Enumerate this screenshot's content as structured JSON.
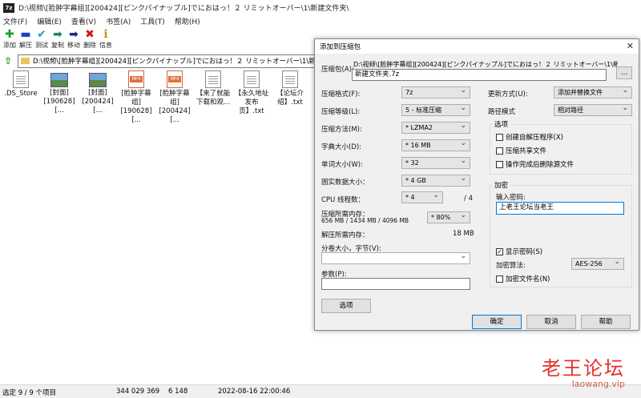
{
  "window": {
    "icon_text": "7z",
    "title": "D:\\视频\\[脸肿字幕组][200424][ピンクパイナップル]でにおはっ！２ リミットオーバー\\1\\新建文件夹\\"
  },
  "menu": [
    "文件(F)",
    "编辑(E)",
    "查看(V)",
    "书签(A)",
    "工具(T)",
    "帮助(H)"
  ],
  "toolbar": [
    {
      "label": "添加",
      "icon": "plus-icon",
      "glyph": "✚",
      "color": "#1aa01a"
    },
    {
      "label": "解压",
      "icon": "minus-icon",
      "glyph": "▬",
      "color": "#2040c0"
    },
    {
      "label": "测试",
      "icon": "check-icon",
      "glyph": "✔",
      "color": "#20a0c0"
    },
    {
      "label": "复制",
      "icon": "copy-arrow-icon",
      "glyph": "➡",
      "color": "#1a8a6a"
    },
    {
      "label": "移动",
      "icon": "move-arrow-icon",
      "glyph": "➡",
      "color": "#1a2a90"
    },
    {
      "label": "删除",
      "icon": "delete-x-icon",
      "glyph": "✖",
      "color": "#d01818"
    },
    {
      "label": "信息",
      "icon": "info-icon",
      "glyph": "ℹ",
      "color": "#c09010"
    }
  ],
  "address": {
    "path": "D:\\视频\\[脸肿字幕组][200424][ピンクパイナップル]でにおはっ！２ リミットオーバー\\1\\新建文件夹\\"
  },
  "files": [
    {
      "name": ".DS_Store",
      "type": "doc"
    },
    {
      "name": "[封面]\n[190628][...",
      "type": "img"
    },
    {
      "name": "[封面]\n[200424][...",
      "type": "img"
    },
    {
      "name": "[脸肿字幕组]\n[190628][...",
      "type": "mp4"
    },
    {
      "name": "[脸肿字幕组]\n[200424][...",
      "type": "mp4"
    },
    {
      "name": "【来了就能\n下载和观...",
      "type": "doc"
    },
    {
      "name": "【永久地址\n发布页】.txt",
      "type": "doc"
    },
    {
      "name": "【论坛介\n绍】.txt",
      "type": "doc"
    }
  ],
  "status": {
    "selection": "选定 9 / 9 个项目",
    "size": "344 029 369",
    "packed": "6 148",
    "modified": "2022-08-16 22:00:46"
  },
  "dialog": {
    "title": "添加到压缩包",
    "close": "✕",
    "archive_label": "压缩包(A):",
    "archive_dir": "D:\\视频\\[脸肿字幕组][200424][ピンクパイナップル]でにおはっ！２ リミットオーバー\\1\\新建文件夹\\",
    "archive_name": "新建文件夹.7z",
    "browse": "...",
    "format_label": "压缩格式(F):",
    "format_value": "7z",
    "level_label": "压缩等级(L):",
    "level_value": "5 - 标准压缩",
    "method_label": "压缩方法(M):",
    "method_value": "* LZMA2",
    "dict_label": "字典大小(D):",
    "dict_value": "* 16 MB",
    "word_label": "单词大小(W):",
    "word_value": "* 32",
    "solid_label": "固实数据大小：",
    "solid_value": "* 4 GB",
    "cpu_label": "CPU 线程数：",
    "cpu_value": "* 4",
    "cpu_total": "/ 4",
    "mem_label": "压缩所需内存：",
    "mem_detail": "656 MB / 1434 MB / 4096 MB",
    "mem_value": "* 80%",
    "decomp_label": "解压所需内存：",
    "decomp_value": "18 MB",
    "split_label": "分卷大小，字节(V):",
    "split_value": "",
    "params_label": "参数(P):",
    "params_value": "",
    "options_button": "选项",
    "update_label": "更新方式(U):",
    "update_value": "添加并替换文件",
    "pathmode_label": "路径模式",
    "pathmode_value": "相对路径",
    "options_group": "选项",
    "opt_sfx": "创建自解压程序(X)",
    "opt_shared": "压缩共享文件",
    "opt_delete": "操作完成后删除源文件",
    "encryption_group": "加密",
    "password_label": "输入密码:",
    "password_value": "上老王论坛当老王",
    "show_password": "显示密码(S)",
    "enc_method_label": "加密算法:",
    "enc_method_value": "AES-256",
    "enc_names": "加密文件名(N)",
    "ok": "确定",
    "cancel": "取消",
    "help": "帮助"
  },
  "watermark": {
    "main": "老王论坛",
    "sub": "laowang.vip"
  }
}
